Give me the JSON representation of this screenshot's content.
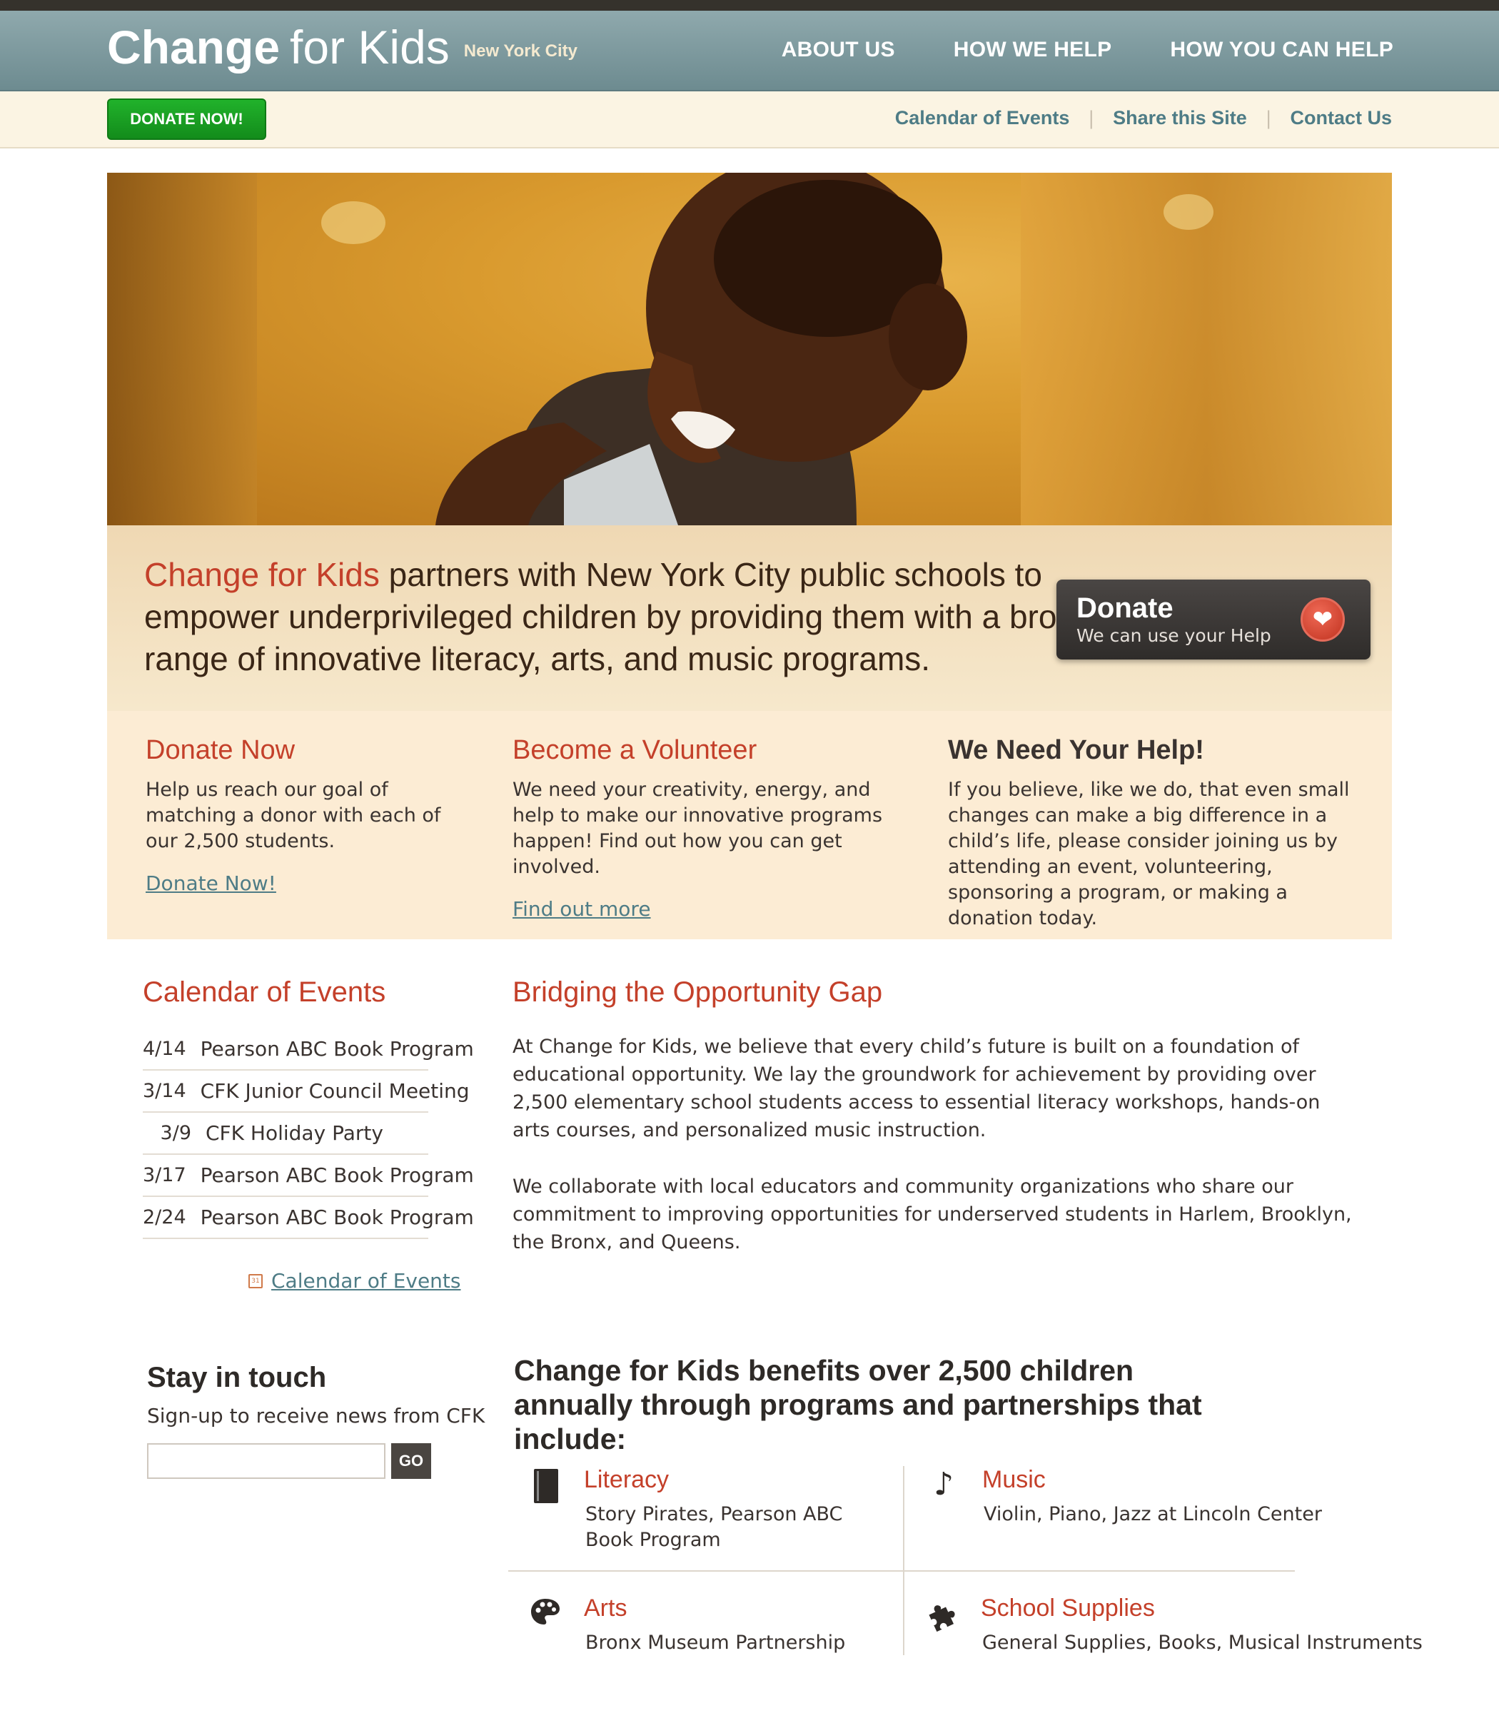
{
  "header": {
    "logo_bold": "Change",
    "logo_light": "for Kids",
    "logo_city": "New York City",
    "nav": [
      "ABOUT US",
      "HOW WE HELP",
      "HOW YOU CAN HELP"
    ]
  },
  "subbar": {
    "donate_button": "DONATE NOW!",
    "links": [
      "Calendar of Events",
      "Share this Site",
      "Contact Us"
    ]
  },
  "hero": {
    "image": "boy-laughing-photo"
  },
  "tagline": {
    "brand": "Change for Kids",
    "text": " partners with New York City public schools to empower underprivileged children by providing them with a broad range of innovative literacy, arts, and music programs."
  },
  "donate_card": {
    "title": "Donate",
    "subtitle": "We can use your Help",
    "icon": "heart-icon"
  },
  "features": [
    {
      "title": "Donate Now",
      "text": "Help us reach our goal of matching a donor with each of our 2,500 students.",
      "link": "Donate Now!"
    },
    {
      "title": "Become a Volunteer",
      "text": "We need your creativity, energy, and help to make our innovative programs happen! Find out how you can get involved.",
      "link": "Find out more"
    },
    {
      "title": "We Need Your Help!",
      "text": "If you believe, like we do, that even small changes can make a big difference in a child’s life, please consider joining us by attending an event, volunteering, sponsoring a program, or making a donation today."
    }
  ],
  "calendar": {
    "title": "Calendar of Events",
    "events": [
      {
        "date": "4/14",
        "name": "Pearson ABC Book Program"
      },
      {
        "date": "3/14",
        "name": "CFK Junior Council Meeting"
      },
      {
        "date": "3/9",
        "name": "CFK Holiday Party"
      },
      {
        "date": "3/17",
        "name": "Pearson ABC Book Program"
      },
      {
        "date": "2/24",
        "name": "Pearson ABC Book Program"
      }
    ],
    "link": "Calendar of Events"
  },
  "bridge": {
    "title": "Bridging the Opportunity Gap",
    "paragraphs": [
      "At Change for Kids, we believe that every child’s future is built on a foundation of educational opportunity. We lay the groundwork for achievement by providing over 2,500 elementary school students access to essential literacy workshops, hands-on arts courses, and personalized music instruction.",
      "We collaborate with local educators and community organizations who share our commitment to improving opportunities for underserved students in Harlem, Brooklyn, the Bronx, and Queens."
    ]
  },
  "stay": {
    "title": "Stay in touch",
    "subtitle": "Sign-up to receive news from CFK",
    "input_value": "",
    "button": "GO"
  },
  "benefits": {
    "title": "Change for Kids benefits over 2,500 children annually through programs and partnerships that include:",
    "items": [
      {
        "icon": "book-icon",
        "title": "Literacy",
        "text": "Story Pirates, Pearson ABC Book Program"
      },
      {
        "icon": "music-note-icon",
        "title": "Music",
        "text": "Violin, Piano, Jazz at Lincoln Center"
      },
      {
        "icon": "palette-icon",
        "title": "Arts",
        "text": "Bronx Museum Partnership"
      },
      {
        "icon": "puzzle-icon",
        "title": "School Supplies",
        "text": "General Supplies, Books, Musical Instruments"
      }
    ]
  },
  "colors": {
    "accent_red": "#c4402a",
    "link_teal": "#4e7c86",
    "header": "#7f9ba0",
    "donate_green": "#1aa423"
  }
}
